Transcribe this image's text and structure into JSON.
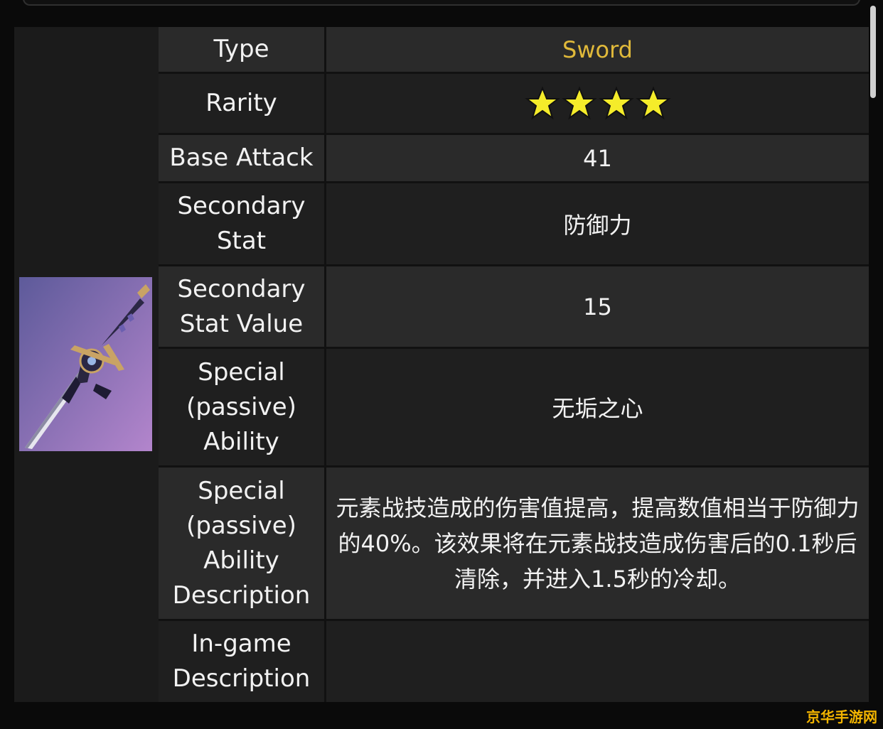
{
  "rows": [
    {
      "label": "Type",
      "value": "Sword"
    },
    {
      "label": "Rarity",
      "value": ""
    },
    {
      "label": "Base Attack",
      "value": "41"
    },
    {
      "label": "Secondary Stat",
      "value": "防御力"
    },
    {
      "label": "Secondary Stat Value",
      "value": "15"
    },
    {
      "label": "Special (passive) Ability",
      "value": "无垢之心"
    },
    {
      "label": "Special (passive) Ability Description",
      "value": "元素战技造成的伤害值提高，提高数值相当于防御力的40%。该效果将在元素战技造成伤害后的0.1秒后清除，并进入1.5秒的冷却。"
    },
    {
      "label": "In-game Description",
      "value": ""
    }
  ],
  "rarity_stars": 4,
  "watermark": "京华手游网",
  "colors": {
    "accent_gold": "#e0b93a",
    "star_fill": "#f5ec2a"
  }
}
